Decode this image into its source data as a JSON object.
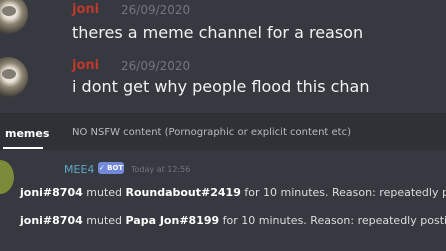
{
  "messages": [
    {
      "author": "joni",
      "timestamp": "26/09/2020",
      "text": "theres a meme channel for a reason",
      "author_color": "#c0392b"
    },
    {
      "author": "joni",
      "timestamp": "26/09/2020",
      "text": "i dont get why people flood this chan",
      "author_color": "#c0392b"
    }
  ],
  "channel": {
    "name": "memes",
    "topic": "NO NSFW content (Pornographic or explicit content etc)"
  },
  "bot_message": {
    "author": "MEE4",
    "badge": "BOT",
    "timestamp": "Today at 12:56",
    "logs": [
      {
        "moderator": "joni#8704",
        "action": "muted",
        "target": "Roundabout#2419",
        "detail": "for 10 minutes. Reason: repeatedly p"
      },
      {
        "moderator": "joni#8704",
        "action": "muted",
        "target": "Papa Jon#8199",
        "detail": "for 10 minutes. Reason: repeatedly posti"
      }
    ]
  },
  "icons": [
    "avatar-icon",
    "bot-avatar-icon"
  ]
}
